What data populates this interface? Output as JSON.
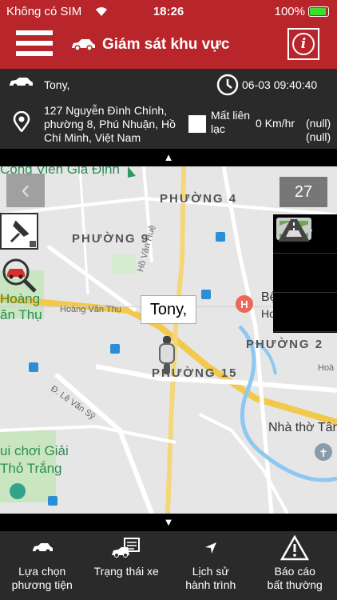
{
  "status_bar": {
    "carrier": "Không có SIM",
    "time": "18:26",
    "battery": "100%"
  },
  "header": {
    "title": "Giám sát khu vực"
  },
  "vehicle": {
    "name": "Tony,",
    "datetime": "06-03 09:40:40",
    "address": "127 Nguyễn Đình Chính, phường 8, Phú Nhuận, Hồ Chí Minh, Việt Nam",
    "connection": "Mất liên lạc",
    "speed": "0 Km/hr",
    "value1": "(null)",
    "value2": "(null)"
  },
  "toggles": {
    "up": "▲",
    "down": "▼"
  },
  "map": {
    "zoom": "27",
    "marker_label": "Tony,",
    "labels": {
      "p4": "PHƯỜNG 4",
      "p9": "PHƯỜNG 9",
      "p2": "PHƯỜNG 2",
      "p15": "PHƯỜNG 15",
      "hoang_van_thu": "Hoàng Văn Thụ",
      "ho_van_hue": "Hồ Văn Huệ",
      "le_van_sy": "Đ. Lê Văn Sỹ",
      "nha_tho": "Nhà thờ Tân",
      "cong_vien": "Công Viên Gia Định",
      "hoang_park": "Hoàng",
      "van_thu_park": "ăn Thụ",
      "vui_choi": "ui chơi Giải",
      "tho_trang": "Thỏ Trắng",
      "hospital": "Bệ",
      "hospital2": "Ho",
      "hoa": "Hoà"
    }
  },
  "bottom_nav": [
    {
      "label1": "Lựa chọn",
      "label2": "phương tiện",
      "icon": "car-icon"
    },
    {
      "label1": "Trạng thái xe",
      "label2": "",
      "icon": "truck-status-icon"
    },
    {
      "label1": "Lịch sử",
      "label2": "hành trình",
      "icon": "navigation-arrow-icon"
    },
    {
      "label1": "Báo cáo",
      "label2": "bất thường",
      "icon": "warning-icon"
    }
  ]
}
